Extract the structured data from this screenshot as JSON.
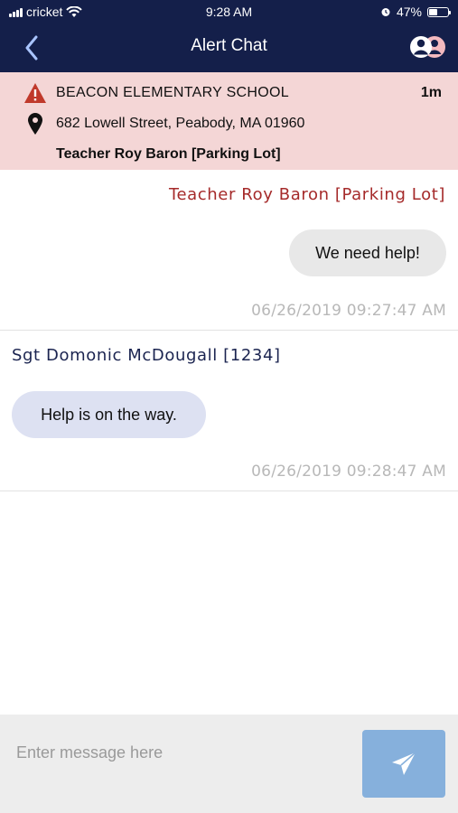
{
  "status_bar": {
    "carrier": "cricket",
    "time": "9:28 AM",
    "battery_percent_label": "47%",
    "battery_level": 0.47
  },
  "nav": {
    "title": "Alert Chat",
    "back_icon": "chevron-left-icon",
    "participants_icon": "people-icon"
  },
  "alert": {
    "school": "BEACON ELEMENTARY SCHOOL",
    "address": "682 Lowell Street, Peabody, MA 01960",
    "reporter": "Teacher Roy Baron [Parking Lot]",
    "age": "1m",
    "colors": {
      "banner": "#f4d6d6",
      "warning": "#c0392b"
    }
  },
  "messages": [
    {
      "sender": "Teacher Roy Baron [Parking Lot]",
      "text": "We need help!",
      "timestamp": "06/26/2019 09:27:47 AM",
      "direction": "outgoing"
    },
    {
      "sender": "Sgt Domonic McDougall [1234]",
      "text": "Help is on the way.",
      "timestamp": "06/26/2019 09:28:47 AM",
      "direction": "incoming"
    }
  ],
  "composer": {
    "placeholder": "Enter message here",
    "send_icon": "send-icon",
    "send_color": "#86b0dc"
  },
  "colors": {
    "header": "#141f4a",
    "outgoing_sender": "#a52a2a",
    "incoming_sender": "#1b2450",
    "incoming_bubble": "#dde1f2",
    "outgoing_bubble": "#e8e8e8"
  }
}
